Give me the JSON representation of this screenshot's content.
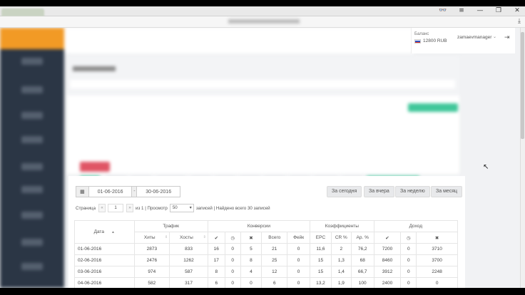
{
  "browser": {
    "win_controls": [
      "👓",
      "≡",
      "—",
      "❐",
      "✕"
    ]
  },
  "header": {
    "balance_label": "Баланс",
    "balance_value": "12800 RUB",
    "username": "zamaevmanager",
    "chevron": "⌄",
    "logout_icon": "⇥",
    "star_icon": "★",
    "download_icon": "⤓"
  },
  "filters": {
    "date_from": "01-06-2016",
    "date_sep": "-",
    "date_to": "30-06-2016",
    "today": "За сегодня",
    "yesterday": "За вчера",
    "week": "За неделю",
    "month": "За месяц"
  },
  "pager": {
    "label_page": "Страница",
    "prev": "«",
    "page_value": "1",
    "next": "»",
    "of_view": "из 1 | Просмотр",
    "per_page": "50",
    "records_text": "записей | Найдено всего 30 записей"
  },
  "table": {
    "group_headers": [
      "Трафик",
      "Конверсии",
      "Коэффициенты",
      "Доход"
    ],
    "date_header": "Дата",
    "sub_headers": [
      "Хиты",
      "Хосты",
      "✔",
      "◷",
      "✖",
      "Всего",
      "Фейк",
      "EPC",
      "CR %",
      "Ap. %",
      "✔",
      "◷",
      "✖"
    ],
    "rows": [
      [
        "01-06-2016",
        "2873",
        "833",
        "16",
        "0",
        "5",
        "21",
        "0",
        "11,6",
        "2",
        "76,2",
        "7200",
        "0",
        "3710"
      ],
      [
        "02-06-2016",
        "2476",
        "1262",
        "17",
        "0",
        "8",
        "25",
        "0",
        "15",
        "1,3",
        "68",
        "8460",
        "0",
        "3700"
      ],
      [
        "03-06-2016",
        "974",
        "587",
        "8",
        "0",
        "4",
        "12",
        "0",
        "15",
        "1,4",
        "66,7",
        "3912",
        "0",
        "2248"
      ],
      [
        "04-06-2016",
        "582",
        "317",
        "6",
        "0",
        "0",
        "6",
        "0",
        "13,2",
        "1,9",
        "100",
        "2400",
        "0",
        "0"
      ]
    ]
  },
  "colors": {
    "accent_orange": "#f29a25",
    "sidebar": "#2b3645",
    "success": "#2db36b",
    "danger": "#e2525f"
  }
}
